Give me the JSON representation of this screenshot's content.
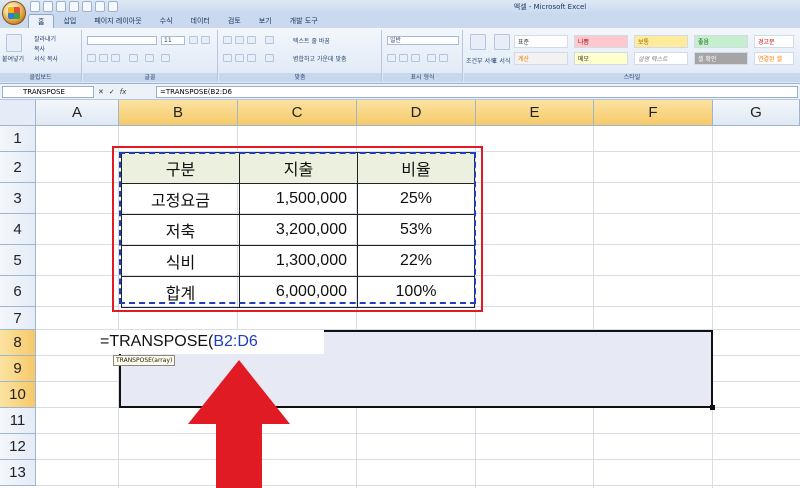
{
  "window": {
    "title": "엑셀 - Microsoft Excel"
  },
  "tabs": [
    "홈",
    "삽입",
    "페이지 레이아웃",
    "수식",
    "데이터",
    "검토",
    "보기",
    "개발 도구"
  ],
  "active_tab": "홈",
  "ribbon": {
    "clipboard": {
      "paste": "붙여넣기",
      "cut": "잘라내기",
      "copy": "복사",
      "format_painter": "서식 복사",
      "label": "클립보드"
    },
    "font": {
      "size": "11",
      "label": "글꼴"
    },
    "alignment": {
      "wrap_text": "텍스트 줄 바꿈",
      "merge_center": "병합하고 가운데 맞춤",
      "label": "맞춤"
    },
    "number": {
      "format": "일반",
      "label": "표시 형식"
    },
    "styles": {
      "conditional": "조건부 서식",
      "table": "표 서식",
      "label": "스타일",
      "cells": [
        "표준",
        "나쁨",
        "보통",
        "좋음",
        "경고문",
        "계산",
        "메모",
        "설명 텍스트",
        "셀 확인",
        "연결된 셀"
      ]
    }
  },
  "formula_bar": {
    "name_box": "TRANSPOSE",
    "cancel": "✕",
    "enter": "✓",
    "fx": "fx",
    "formula": "=TRANSPOSE(B2:D6"
  },
  "columns": [
    "A",
    "B",
    "C",
    "D",
    "E",
    "F",
    "G"
  ],
  "rows": [
    "1",
    "2",
    "3",
    "4",
    "5",
    "6",
    "7",
    "8",
    "9",
    "10",
    "11",
    "12",
    "13"
  ],
  "table": {
    "header": [
      "구분",
      "지출",
      "비율"
    ],
    "rows": [
      [
        "고정요금",
        "1,500,000",
        "25%"
      ],
      [
        "저축",
        "3,200,000",
        "53%"
      ],
      [
        "식비",
        "1,300,000",
        "22%"
      ],
      [
        "합계",
        "6,000,000",
        "100%"
      ]
    ]
  },
  "edit_cell": {
    "prefix": "=TRANSPOSE(",
    "ref": "B2:D6"
  },
  "tooltip": "TRANSPOSE(array)",
  "colors": {
    "highlight_red": "#e01b24",
    "reference_blue": "#1f3fbf",
    "header_fill": "#ebf1de",
    "selection_fill": "#e7e9f4"
  }
}
